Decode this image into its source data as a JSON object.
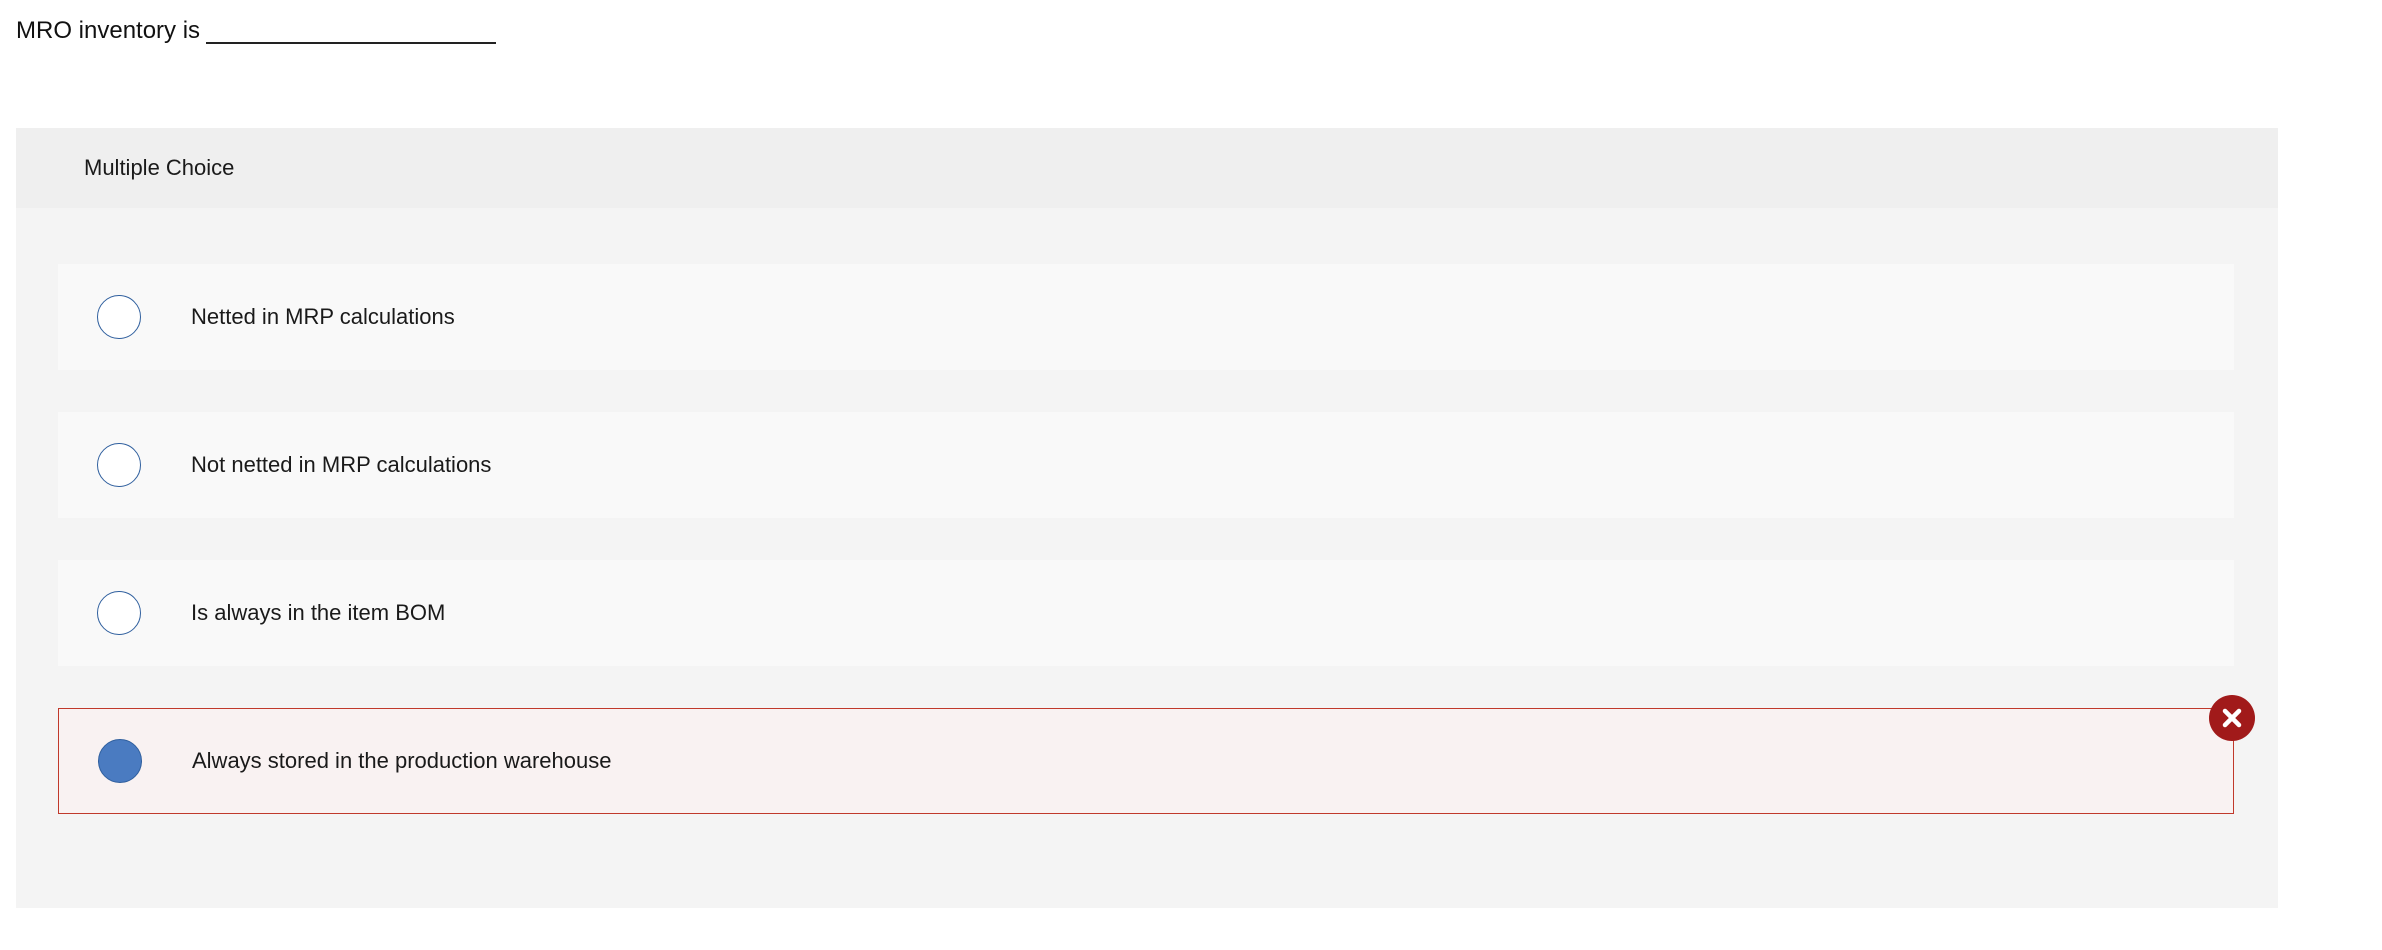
{
  "question": {
    "text": "MRO inventory is"
  },
  "panel": {
    "title": "Multiple Choice"
  },
  "options": [
    {
      "label": "Netted in MRP calculations",
      "selected": false,
      "state": "default"
    },
    {
      "label": "Not netted in MRP calculations",
      "selected": false,
      "state": "default"
    },
    {
      "label": "Is always in the item BOM",
      "selected": false,
      "state": "default"
    },
    {
      "label": "Always stored in the production warehouse",
      "selected": true,
      "state": "incorrect"
    }
  ],
  "colors": {
    "radio_border": "#2f5f9e",
    "radio_selected": "#4a7bc1",
    "incorrect_border": "#c0392b",
    "incorrect_badge": "#a11a1a"
  },
  "icons": {
    "incorrect_badge": "close-icon"
  }
}
